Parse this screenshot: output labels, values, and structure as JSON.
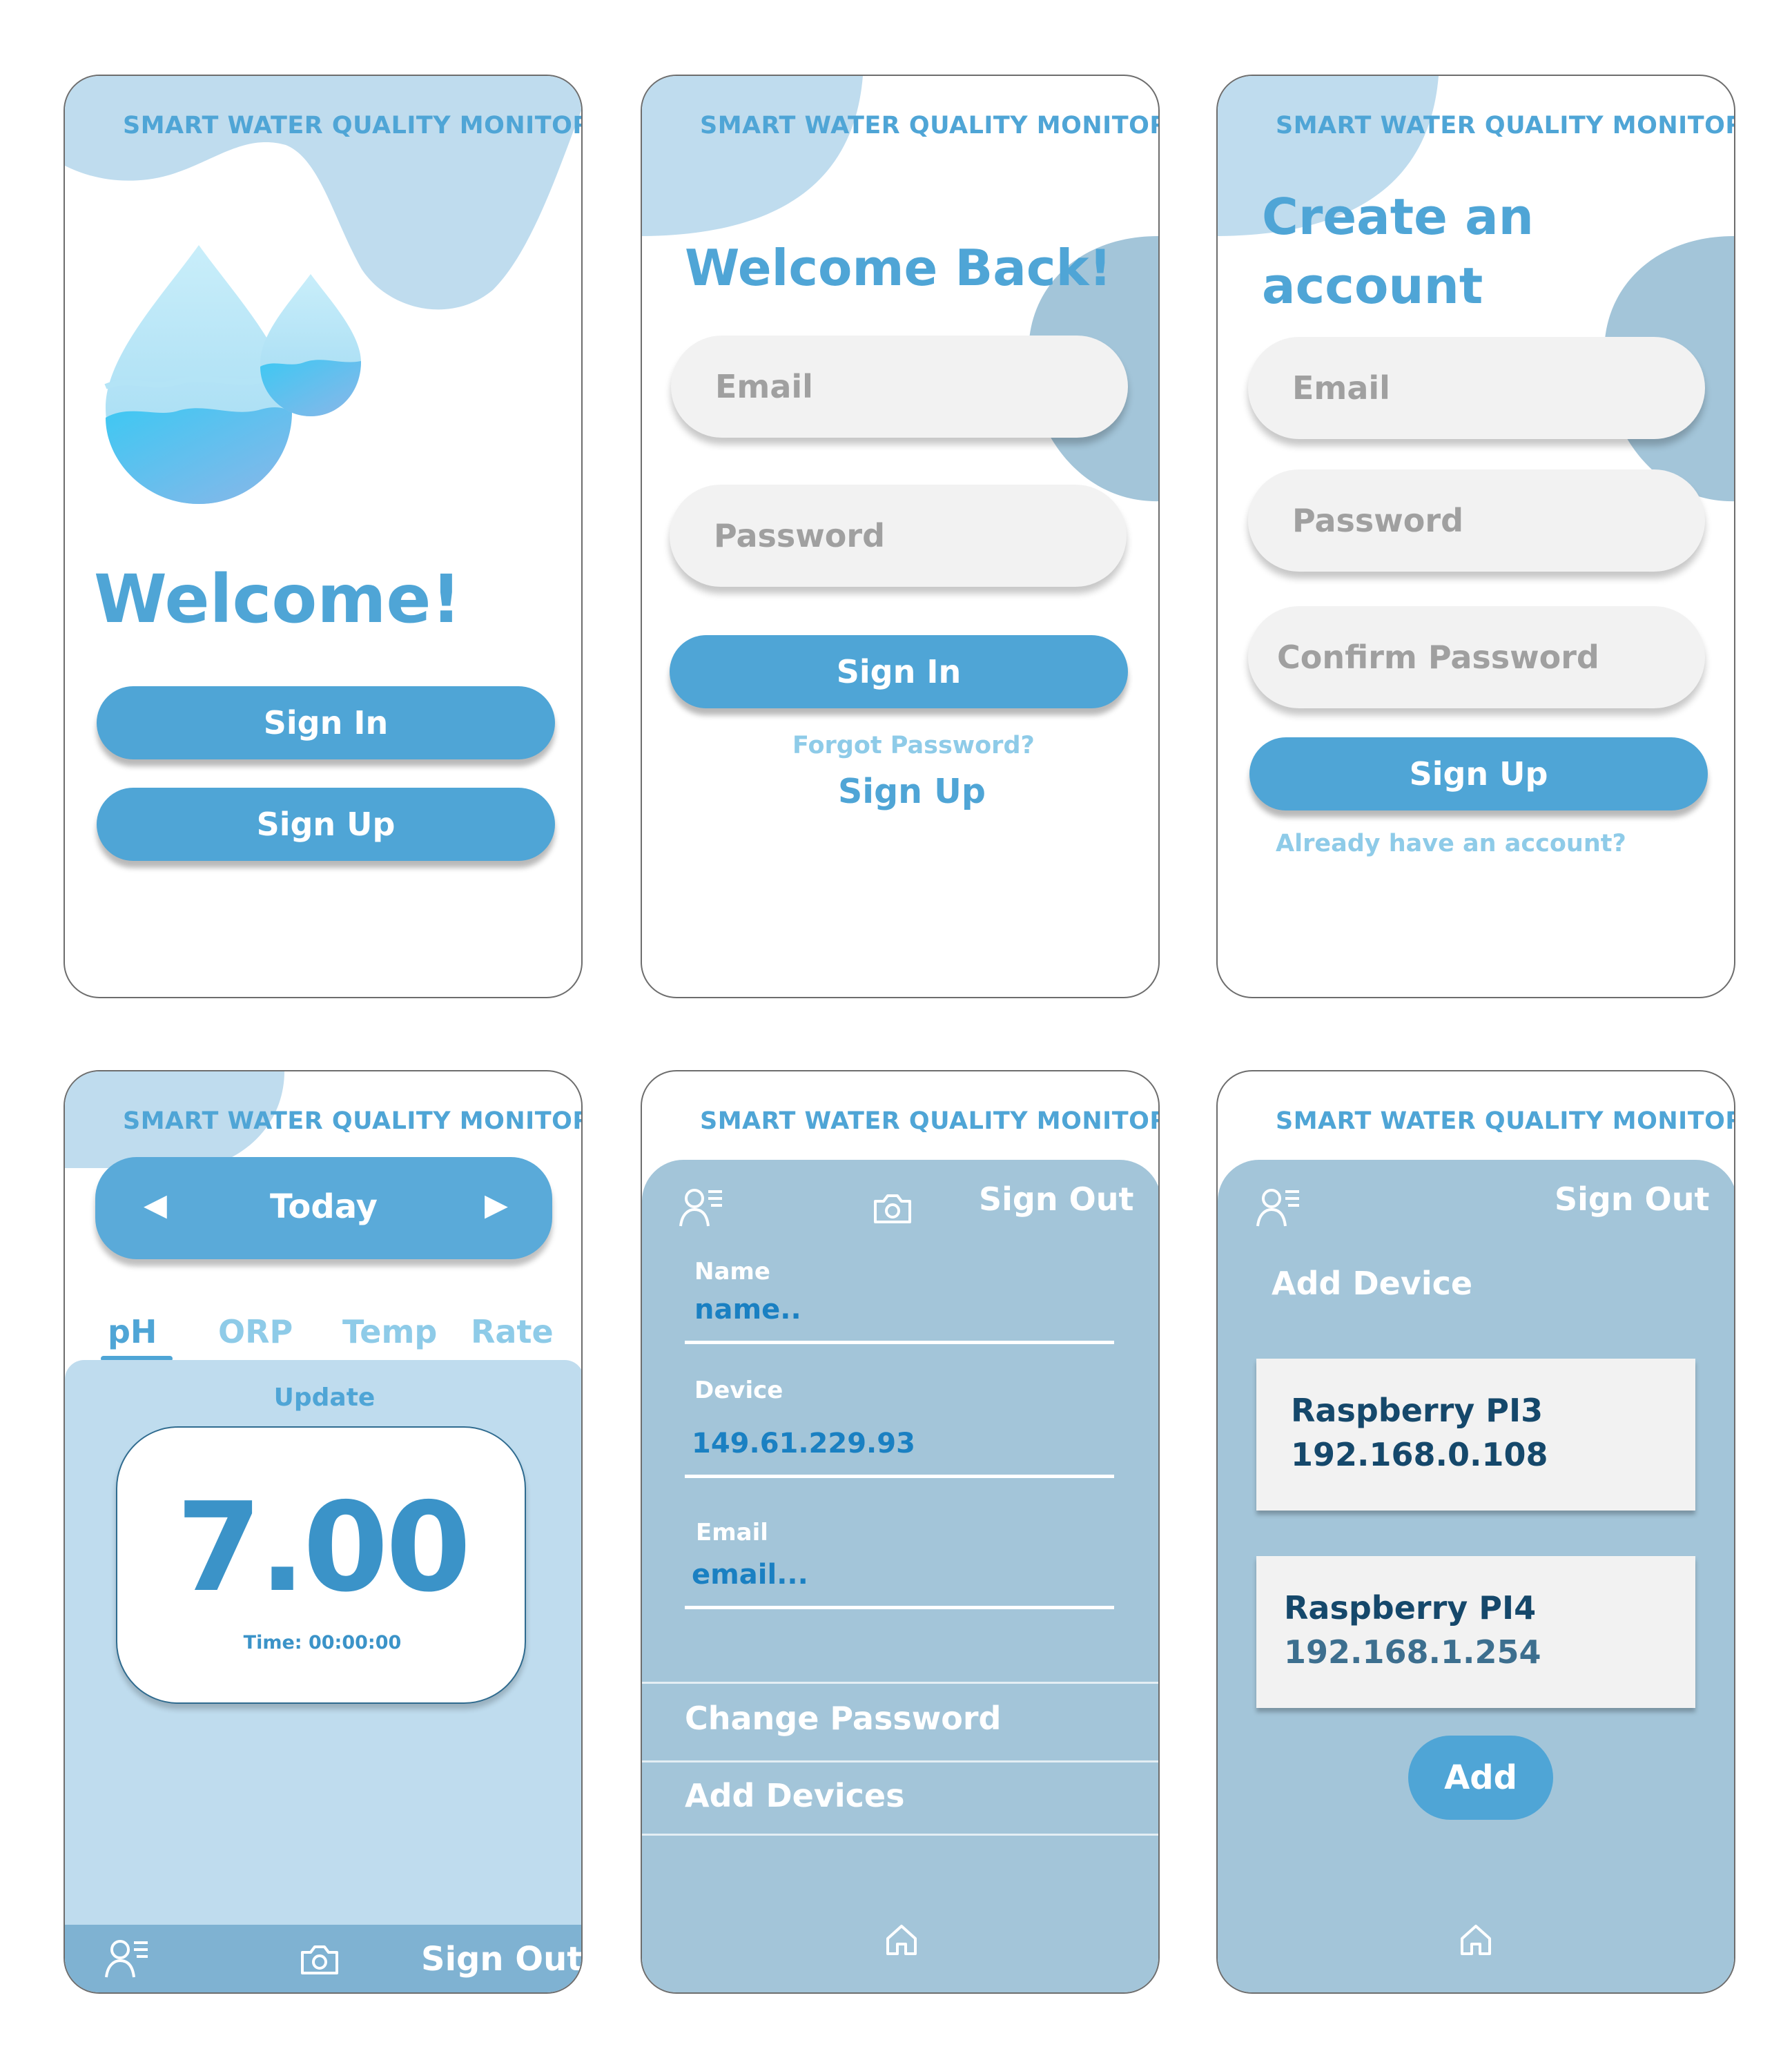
{
  "brand": "SMART WATER QUALITY MONITOR",
  "welcome_screen": {
    "heading": "Welcome!",
    "sign_in": "Sign In",
    "sign_up": "Sign Up"
  },
  "signin_screen": {
    "heading": "Welcome Back!",
    "email_placeholder": "Email",
    "password_placeholder": "Password",
    "sign_in": "Sign In",
    "forgot": "Forgot Password?",
    "sign_up": "Sign Up"
  },
  "signup_screen": {
    "heading_line1": "Create an",
    "heading_line2": "account",
    "email_placeholder": "Email",
    "password_placeholder": "Password",
    "confirm_placeholder": "Confirm Password",
    "sign_up": "Sign Up",
    "already": "Already have an account?"
  },
  "dashboard_screen": {
    "prev_glyph": "◀",
    "date_label": "Today",
    "next_glyph": "▶",
    "tabs": [
      {
        "label": "pH",
        "active": true
      },
      {
        "label": "ORP",
        "active": false
      },
      {
        "label": "Temp",
        "active": false
      },
      {
        "label": "Rate",
        "active": false
      }
    ],
    "update_label": "Update",
    "reading_value": "7.00",
    "reading_time": "Time: 00:00:00",
    "sign_out": "Sign Out",
    "icons": [
      "user-list-icon",
      "camera-icon"
    ]
  },
  "profile_screen": {
    "sign_out": "Sign Out",
    "name_label": "Name",
    "name_value": "name..",
    "device_label": "Device",
    "device_value": "149.61.229.93",
    "email_label": "Email",
    "email_value": "email...",
    "change_password": "Change Password",
    "add_devices": "Add Devices",
    "icons": [
      "user-list-icon",
      "camera-icon",
      "home-icon"
    ]
  },
  "devices_screen": {
    "sign_out": "Sign Out",
    "heading": "Add Device",
    "devices": [
      {
        "name": "Raspberry PI3",
        "ip": "192.168.0.108"
      },
      {
        "name": "Raspberry PI4",
        "ip": "192.168.1.254"
      }
    ],
    "add": "Add",
    "icons": [
      "user-list-icon",
      "home-icon"
    ]
  },
  "colors": {
    "accent": "#4fa5d6",
    "light_blue": "#bfdcee",
    "panel_blue": "#a3c5d9",
    "dark_text": "#15486b"
  }
}
